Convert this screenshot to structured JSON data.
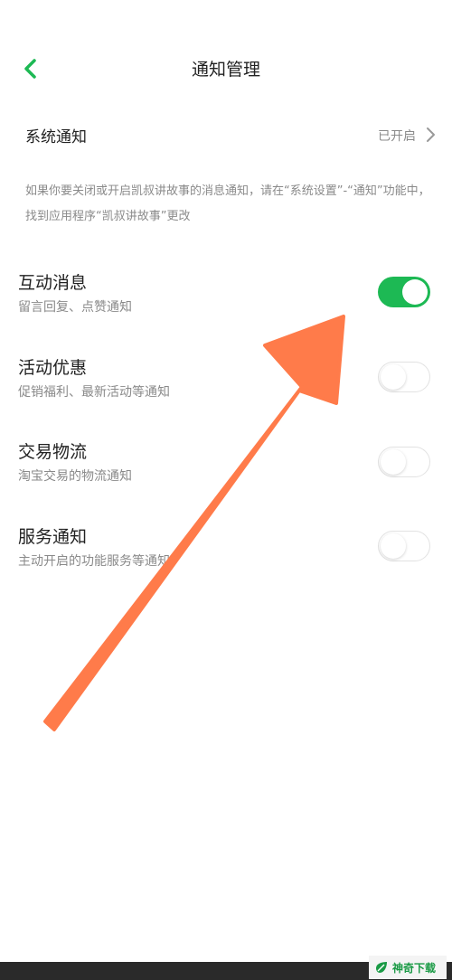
{
  "header": {
    "title": "通知管理",
    "back_icon": "chevron-left-icon"
  },
  "colors": {
    "accent": "#1db954",
    "arrow": "#ff7b4a",
    "secondary_text": "#8a8a8a"
  },
  "system_notification": {
    "label": "系统通知",
    "status": "已开启"
  },
  "hint_text": "如果你要关闭或开启凯叔讲故事的消息通知，请在“系统设置”-“通知”功能中，找到应用程序“凯叔讲故事”更改",
  "settings": [
    {
      "title": "互动消息",
      "subtitle": "留言回复、点赞通知",
      "enabled": true
    },
    {
      "title": "活动优惠",
      "subtitle": "促销福利、最新活动等通知",
      "enabled": false
    },
    {
      "title": "交易物流",
      "subtitle": "淘宝交易的物流通知",
      "enabled": false
    },
    {
      "title": "服务通知",
      "subtitle": "主动开启的功能服务等通知",
      "enabled": false
    }
  ],
  "watermark": {
    "text": "神奇下载"
  }
}
